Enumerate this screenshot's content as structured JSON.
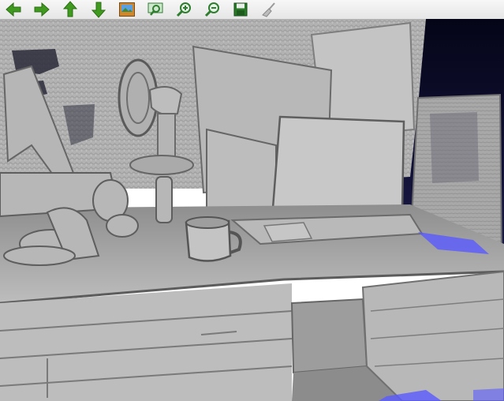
{
  "toolbar": {
    "buttons": [
      {
        "id": "back",
        "icon": "arrow-left-icon",
        "tooltip": ""
      },
      {
        "id": "forward",
        "icon": "arrow-right-icon",
        "tooltip": ""
      },
      {
        "id": "up",
        "icon": "arrow-up-icon",
        "tooltip": ""
      },
      {
        "id": "down",
        "icon": "arrow-down-icon",
        "tooltip": ""
      },
      {
        "id": "snapshot",
        "icon": "image-icon",
        "tooltip": ""
      },
      {
        "id": "zoom-fit",
        "icon": "zoom-fit-icon",
        "tooltip": ""
      },
      {
        "id": "zoom-in",
        "icon": "zoom-in-icon",
        "tooltip": ""
      },
      {
        "id": "zoom-out",
        "icon": "zoom-out-icon",
        "tooltip": ""
      },
      {
        "id": "save",
        "icon": "save-icon",
        "tooltip": ""
      },
      {
        "id": "clear",
        "icon": "broom-icon",
        "tooltip": ""
      }
    ],
    "colors": {
      "arrow": "#3f9a1f",
      "zoom": "#2f7d2f",
      "save": "#2a7a2a",
      "broom": "#9a9a9a"
    }
  },
  "viewport": {
    "content": "3d-reconstruction-mesh",
    "colors": {
      "background": "#0c0c2e",
      "mesh": "#b4b4b4",
      "mesh_shadow": "#6e6e6e",
      "mesh_highlight": "#e2e2e2",
      "artifact": "#5a5aff"
    }
  }
}
